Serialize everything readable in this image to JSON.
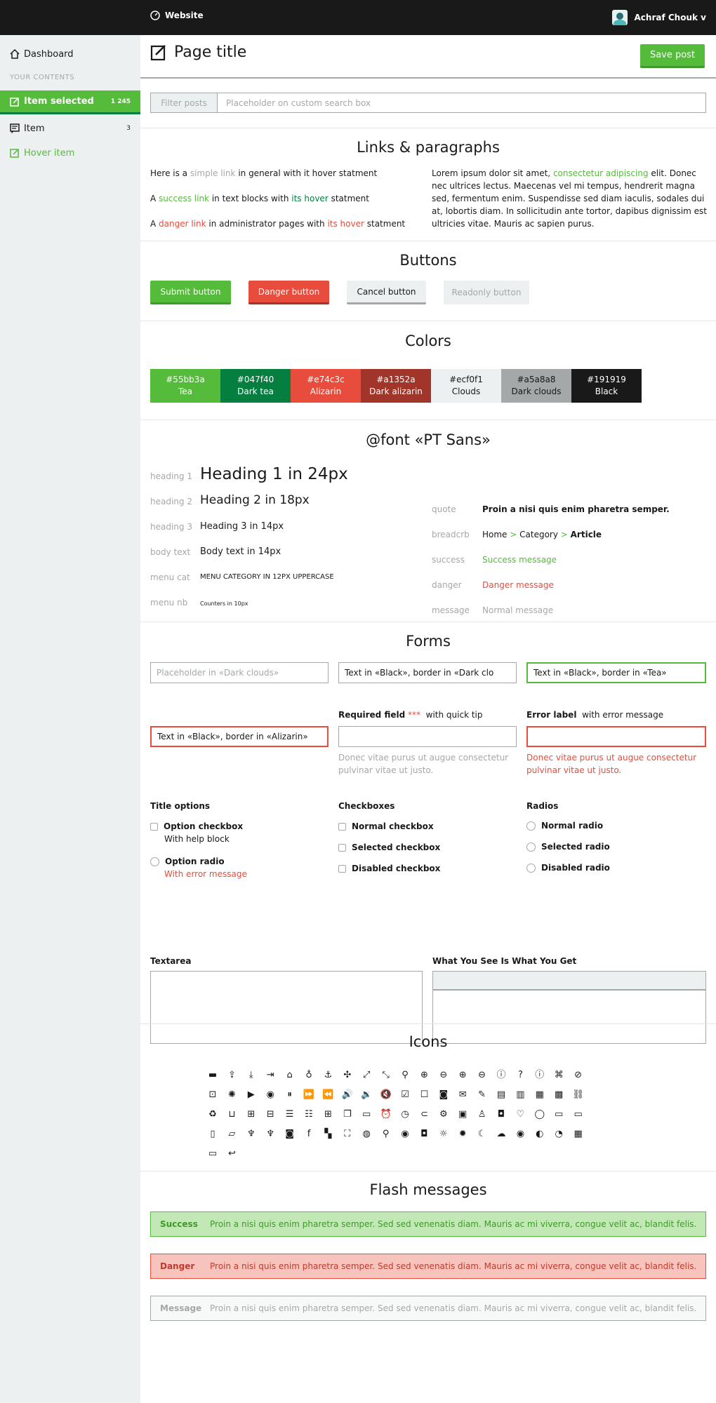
{
  "topbar": {
    "brand": "Website",
    "user": "Achraf Chouk v"
  },
  "sidebar": {
    "dashboard": "Dashboard",
    "category": "YOUR CONTENTS",
    "selected": {
      "label": "Item selected",
      "count": "1 245"
    },
    "item": {
      "label": "Item",
      "count": "3"
    },
    "hover": "Hover item"
  },
  "header": {
    "title": "Page title",
    "save": "Save post"
  },
  "filter": {
    "label": "Filter posts",
    "placeholder": "Placeholder on custom search box"
  },
  "links": {
    "title": "Links & paragraphs",
    "l1a": "Here is a ",
    "l1b": "simple link",
    "l1c": " in general with it hover statment",
    "l2a": "A ",
    "l2b": "success link",
    "l2c": " in text blocks with ",
    "l2d": "its hover",
    "l2e": " statment",
    "l3a": "A ",
    "l3b": "danger link",
    "l3c": " in administrator pages with ",
    "l3d": "its hover",
    "l3e": " statment",
    "p1": "Lorem ipsum dolor sit amet, ",
    "p2": "consectetur adipiscing",
    "p3": " elit. Donec nec ultrices lectus. Maecenas vel mi tempus, hendrerit magna sed, fermentum enim. Suspendisse sed diam iaculis, sodales dui at, lobortis diam. In sollicitudin ante tortor, dapibus dignissim est ultricies vitae. Mauris ac sapien purus."
  },
  "buttons": {
    "title": "Buttons",
    "submit": "Submit button",
    "danger": "Danger button",
    "cancel": "Cancel button",
    "readonly": "Readonly button"
  },
  "colors": {
    "title": "Colors",
    "swatches": [
      {
        "hex": "#55bb3a",
        "name": "Tea",
        "bg": "#55bb3a",
        "fg": "#ffffff"
      },
      {
        "hex": "#047f40",
        "name": "Dark tea",
        "bg": "#047f40",
        "fg": "#ffffff"
      },
      {
        "hex": "#e74c3c",
        "name": "Alizarin",
        "bg": "#e74c3c",
        "fg": "#ffffff"
      },
      {
        "hex": "#a1352a",
        "name": "Dark alizarin",
        "bg": "#a1352a",
        "fg": "#ffffff"
      },
      {
        "hex": "#ecf0f1",
        "name": "Clouds",
        "bg": "#ecf0f1",
        "fg": "#191919"
      },
      {
        "hex": "#a5a8a8",
        "name": "Dark clouds",
        "bg": "#a5a8a8",
        "fg": "#191919"
      },
      {
        "hex": "#191919",
        "name": "Black",
        "bg": "#191919",
        "fg": "#ffffff"
      }
    ]
  },
  "font": {
    "title": "@font «PT Sans»",
    "left": [
      {
        "label": "heading 1",
        "value": "Heading 1 in 24px"
      },
      {
        "label": "heading 2",
        "value": "Heading 2 in 18px"
      },
      {
        "label": "heading 3",
        "value": "Heading 3 in 14px"
      },
      {
        "label": "body text",
        "value": "Body text in 14px"
      },
      {
        "label": "menu cat",
        "value": "MENU CATEGORY IN 12PX UPPERCASE"
      },
      {
        "label": "menu nb",
        "value": "Counters in 10px"
      }
    ],
    "quote_label": "quote",
    "quote": "Proin a nisi quis enim pharetra semper.",
    "breadcrumb_label": "breadcrb",
    "bc_home": "Home",
    "bc_sep": " > ",
    "bc_cat": "Category",
    "bc_art": "Article",
    "success_label": "success",
    "success": "Success message",
    "danger_label": "danger",
    "danger": "Danger message",
    "message_label": "message",
    "message": "Normal message"
  },
  "forms": {
    "title": "Forms",
    "in1_placeholder": "Placeholder in «Dark clouds»",
    "in2": "Text in «Black», border in «Dark clo",
    "in3": "Text in «Black», border in «Tea»",
    "in4": "Text in «Black», border in «Alizarin»",
    "req_label": "Required field",
    "req_mark": "***",
    "req_tip": "with quick tip",
    "req_hint": "Donec vitae purus ut augue consectetur pulvinar vitae ut justo.",
    "err_label": "Error label",
    "err_tip": "with error message",
    "err_hint": "Donec vitae purus ut augue consectetur pulvinar vitae ut justo.",
    "title_options": "Title options",
    "opt_checkbox": "Option checkbox",
    "opt_help": "With help block",
    "opt_radio": "Option radio",
    "opt_error": "With error message",
    "checkboxes": "Checkboxes",
    "cb1": "Normal checkbox",
    "cb2": "Selected checkbox",
    "cb3": "Disabled checkbox",
    "radios": "Radios",
    "r1": "Normal radio",
    "r2": "Selected radio",
    "r3": "Disabled radio",
    "textarea": "Textarea",
    "wysiwyg": "What You See Is What You Get"
  },
  "icons": {
    "title": "Icons",
    "list": [
      {
        "n": "store-icon",
        "g": "▬"
      },
      {
        "n": "upload-icon",
        "g": "⇪"
      },
      {
        "n": "download-icon",
        "g": "⤓"
      },
      {
        "n": "login-icon",
        "g": "⇥"
      },
      {
        "n": "home-icon",
        "g": "⌂"
      },
      {
        "n": "bulb-icon",
        "g": "♁"
      },
      {
        "n": "anchor-icon",
        "g": "⚓"
      },
      {
        "n": "expand-icon",
        "g": "✣"
      },
      {
        "n": "fullscreen-icon",
        "g": "⤢"
      },
      {
        "n": "resize-icon",
        "g": "⤡"
      },
      {
        "n": "search-icon",
        "g": "⚲"
      },
      {
        "n": "zoom-in-icon",
        "g": "⊕"
      },
      {
        "n": "zoom-out-icon",
        "g": "⊖"
      },
      {
        "n": "plus-circle-icon",
        "g": "⊕"
      },
      {
        "n": "minus-circle-icon",
        "g": "⊖"
      },
      {
        "n": "alert-icon",
        "g": "ⓘ"
      },
      {
        "n": "help-icon",
        "g": "?"
      },
      {
        "n": "info-icon",
        "g": "ⓘ"
      },
      {
        "n": "command-icon",
        "g": "⌘"
      },
      {
        "n": "forbidden-icon",
        "g": "⊘"
      },
      {
        "n": "book-icon",
        "g": "⊡"
      },
      {
        "n": "spinner-icon",
        "g": "✺"
      },
      {
        "n": "play-icon",
        "g": "▶"
      },
      {
        "n": "stop-icon",
        "g": "◉"
      },
      {
        "n": "pause-icon",
        "g": "⏸"
      },
      {
        "n": "forward-icon",
        "g": "⏩"
      },
      {
        "n": "rewind-icon",
        "g": "⏪"
      },
      {
        "n": "volume-up-icon",
        "g": "🔊"
      },
      {
        "n": "volume-icon",
        "g": "🔉"
      },
      {
        "n": "mute-icon",
        "g": "🔇"
      },
      {
        "n": "checked-box-icon",
        "g": "☑"
      },
      {
        "n": "comment-box-icon",
        "g": "☐"
      },
      {
        "n": "badge-icon",
        "g": "◙"
      },
      {
        "n": "mail-icon",
        "g": "✉"
      },
      {
        "n": "edit-icon",
        "g": "✎"
      },
      {
        "n": "news-icon",
        "g": "▤"
      },
      {
        "n": "doc-icon",
        "g": "▥"
      },
      {
        "n": "lock-doc-icon",
        "g": "▦"
      },
      {
        "n": "calendar-grid-icon",
        "g": "▩"
      },
      {
        "n": "link-icon",
        "g": "⛓"
      },
      {
        "n": "trash-icon",
        "g": "♻"
      },
      {
        "n": "bin-icon",
        "g": "⊔"
      },
      {
        "n": "grid-icon",
        "g": "⊞"
      },
      {
        "n": "grid-alt-icon",
        "g": "⊟"
      },
      {
        "n": "list-icon",
        "g": "☰"
      },
      {
        "n": "list-alt-icon",
        "g": "☷"
      },
      {
        "n": "calculator-icon",
        "g": "⊞"
      },
      {
        "n": "copy-icon",
        "g": "❐"
      },
      {
        "n": "window-icon",
        "g": "▭"
      },
      {
        "n": "alarm-icon",
        "g": "⏰"
      },
      {
        "n": "clock-icon",
        "g": "◷"
      },
      {
        "n": "attach-icon",
        "g": "⊂"
      },
      {
        "n": "settings-icon",
        "g": "⚙"
      },
      {
        "n": "briefcase-icon",
        "g": "▣"
      },
      {
        "n": "stamp-icon",
        "g": "♙"
      },
      {
        "n": "bag-icon",
        "g": "◘"
      },
      {
        "n": "heart-icon",
        "g": "♡"
      },
      {
        "n": "chat-icon",
        "g": "◯"
      },
      {
        "n": "chat-box-icon",
        "g": "▭"
      },
      {
        "n": "desktop-icon",
        "g": "▭"
      },
      {
        "n": "tablet-icon",
        "g": "▯"
      },
      {
        "n": "laptop-icon",
        "g": "▱"
      },
      {
        "n": "fork-knife-icon",
        "g": "♆"
      },
      {
        "n": "restaurant-icon",
        "g": "♆"
      },
      {
        "n": "instagram-icon",
        "g": "◙"
      },
      {
        "n": "facebook-icon",
        "g": "f"
      },
      {
        "n": "qr-icon",
        "g": "▚"
      },
      {
        "n": "focus-icon",
        "g": "⛶"
      },
      {
        "n": "dribbble-icon",
        "g": "◍"
      },
      {
        "n": "pin-icon",
        "g": "⚲"
      },
      {
        "n": "pin-alt-icon",
        "g": "◉"
      },
      {
        "n": "camera-icon",
        "g": "◘"
      },
      {
        "n": "sun-icon",
        "g": "☼"
      },
      {
        "n": "brightness-icon",
        "g": "✹"
      },
      {
        "n": "moon-icon",
        "g": "☾"
      },
      {
        "n": "cloud-icon",
        "g": "☁"
      },
      {
        "n": "record-icon",
        "g": "◉"
      },
      {
        "n": "contrast-icon",
        "g": "◐"
      },
      {
        "n": "compass-icon",
        "g": "◔"
      },
      {
        "n": "calendar-icon",
        "g": "▦"
      },
      {
        "n": "tv-icon",
        "g": "▭"
      },
      {
        "n": "reply-icon",
        "g": "↩"
      }
    ]
  },
  "flash": {
    "title": "Flash messages",
    "success_t": "Success",
    "danger_t": "Danger",
    "message_t": "Message",
    "text": "Proin a nisi quis enim pharetra semper. Sed sed venenatis diam. Mauris ac mi viverra, congue velit ac, blandit felis."
  }
}
